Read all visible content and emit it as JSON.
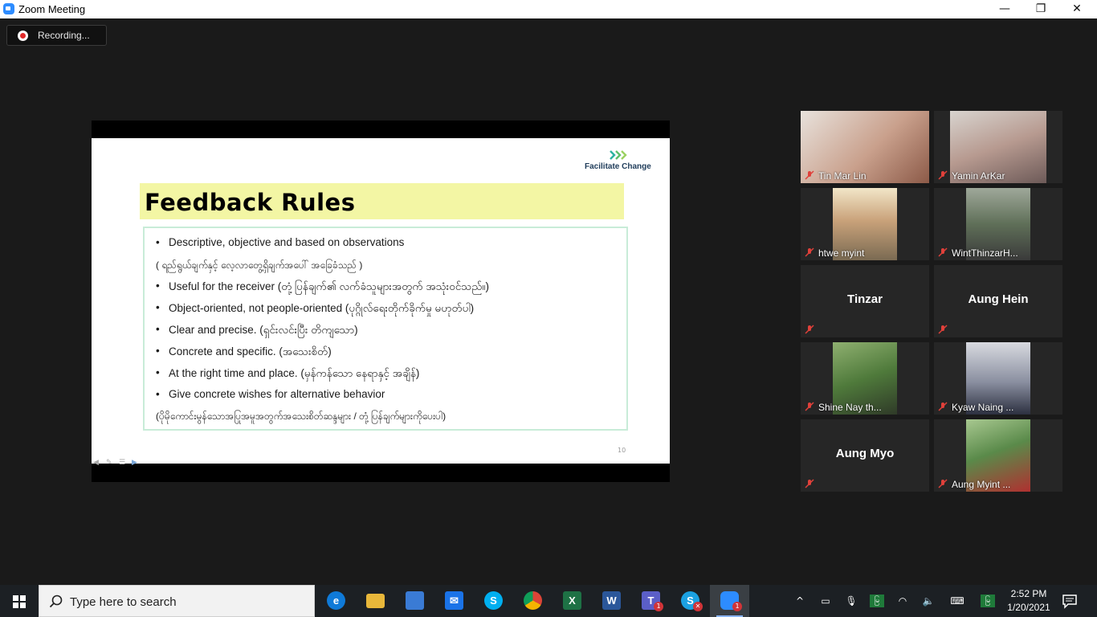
{
  "window": {
    "title": "Zoom Meeting",
    "minimize": "—",
    "restore": "❐",
    "close": "✕"
  },
  "recording": {
    "label": "Recording..."
  },
  "slide": {
    "logo_text": "Facilitate Change",
    "title": "Feedback Rules",
    "lines": [
      {
        "text": "Descriptive, objective and based on observations",
        "bullet": true
      },
      {
        "text": "( ရည်ရွယ်ချက်နှင့် လေ့လာတွေ့ရှိချက်အပေါ် အခြေခံသည် )",
        "bullet": false
      },
      {
        "text": "Useful for the receiver (တုံ့ပြန်ချက်၏ လက်ခံသူများအတွက် အသုံးဝင်သည်။)",
        "bullet": true
      },
      {
        "text": "Object-oriented, not people-oriented (ပုဂ္ဂိုလ်ရေးတိုက်ခိုက်မှု မဟုတ်ပါ)",
        "bullet": true
      },
      {
        "text": "Clear and precise. (ရှင်းလင်းပြီး တိကျသော)",
        "bullet": true
      },
      {
        "text": "Concrete and specific. (အသေးစိတ်)",
        "bullet": true
      },
      {
        "text": "At the right time and place. (မှန်ကန်သော နေရာနှင့် အချိန်)",
        "bullet": true
      },
      {
        "text": "Give concrete wishes for alternative behavior",
        "bullet": true
      },
      {
        "text": "(ပိုမိုကောင်းမွန်သောအပြုအမူအတွက်အသေးစိတ်ဆန္ဒများ / တုံ့ပြန်ချက်များကိုပေးပါ)",
        "bullet": false
      }
    ],
    "page_number": "10"
  },
  "participants": [
    {
      "name": "Tin Mar Lin",
      "video": true,
      "color": "#b98a7a"
    },
    {
      "name": "Yamin ArKar",
      "video": true,
      "color": "#9c8f86"
    },
    {
      "name": "htwe myint",
      "video": true,
      "color": "#c9a27a"
    },
    {
      "name": "WintThinzarH...",
      "video": true,
      "color": "#5f6f58"
    },
    {
      "name": "Tinzar",
      "video": false
    },
    {
      "name": "Aung Hein",
      "video": false
    },
    {
      "name": "Shine Nay th...",
      "video": true,
      "color": "#4f7a3b"
    },
    {
      "name": "Kyaw Naing ...",
      "video": true,
      "color": "#8a8fa0"
    },
    {
      "name": "Aung Myo",
      "video": false
    },
    {
      "name": "Aung Myint ...",
      "video": true,
      "color": "#5a8a4a"
    }
  ],
  "taskbar": {
    "search_placeholder": "Type here to search",
    "apps": [
      {
        "name": "edge",
        "glyph": "e",
        "color": "#0f7ad8",
        "active": false,
        "badge": ""
      },
      {
        "name": "file-explorer",
        "glyph": "",
        "color": "#e8b73a",
        "active": false,
        "badge": ""
      },
      {
        "name": "store",
        "glyph": "",
        "color": "#3a7bd5",
        "active": false,
        "badge": ""
      },
      {
        "name": "mail",
        "glyph": "✉",
        "color": "#1a73e8",
        "active": false,
        "badge": ""
      },
      {
        "name": "skype",
        "glyph": "S",
        "color": "#00aff0",
        "active": false,
        "badge": ""
      },
      {
        "name": "chrome",
        "glyph": "",
        "color": "#db4437",
        "active": false,
        "badge": ""
      },
      {
        "name": "excel",
        "glyph": "X",
        "color": "#1e7145",
        "active": false,
        "badge": ""
      },
      {
        "name": "word",
        "glyph": "W",
        "color": "#2b579a",
        "active": false,
        "badge": ""
      },
      {
        "name": "teams",
        "glyph": "T",
        "color": "#5b5fc7",
        "active": false,
        "badge": "1"
      },
      {
        "name": "skype-business",
        "glyph": "S",
        "color": "#1ba1e2",
        "active": false,
        "badge": "✕"
      },
      {
        "name": "zoom",
        "glyph": "",
        "color": "#2d8cff",
        "active": true,
        "badge": "1"
      }
    ],
    "tray_lang": "မြ",
    "time": "2:52 PM",
    "date": "1/20/2021"
  }
}
